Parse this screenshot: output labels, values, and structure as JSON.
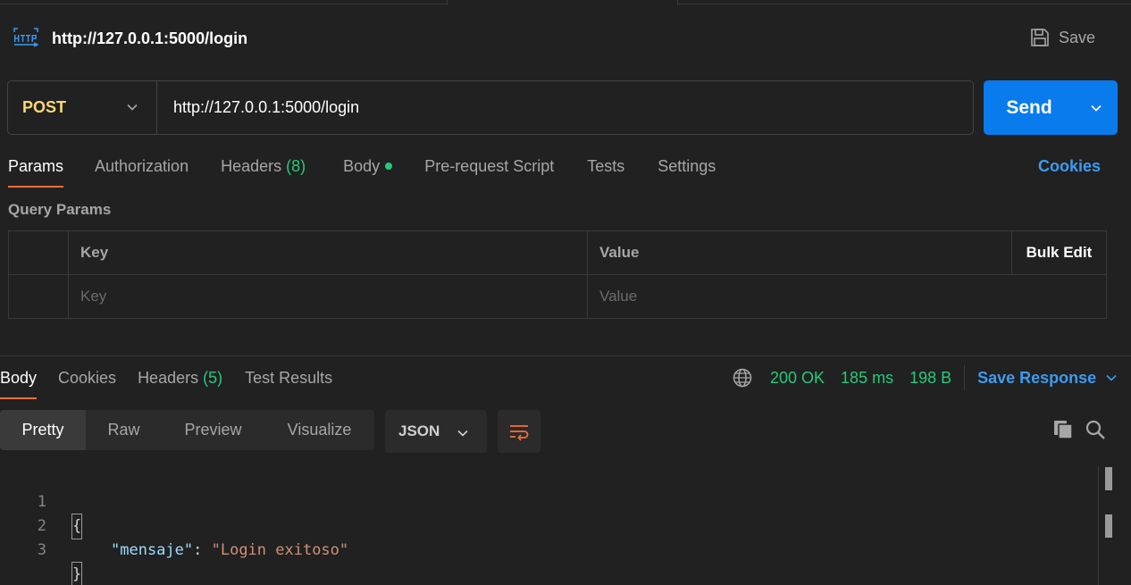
{
  "request": {
    "title": "http://127.0.0.1:5000/login",
    "save_label": "Save",
    "method": "POST",
    "url": "http://127.0.0.1:5000/login",
    "send_label": "Send"
  },
  "request_tabs": [
    {
      "label": "Params",
      "active": true
    },
    {
      "label": "Authorization"
    },
    {
      "label": "Headers",
      "count": "(8)"
    },
    {
      "label": "Body",
      "has_dot": true
    },
    {
      "label": "Pre-request Script"
    },
    {
      "label": "Tests"
    },
    {
      "label": "Settings"
    }
  ],
  "cookies_label": "Cookies",
  "query_params": {
    "title": "Query Params",
    "columns": {
      "key": "Key",
      "value": "Value",
      "bulk_edit": "Bulk Edit"
    },
    "placeholders": {
      "key": "Key",
      "value": "Value"
    }
  },
  "response_tabs": [
    {
      "label": "Body",
      "active": true
    },
    {
      "label": "Cookies"
    },
    {
      "label": "Headers",
      "count": "(5)"
    },
    {
      "label": "Test Results"
    }
  ],
  "response_status": {
    "status": "200 OK",
    "time": "185 ms",
    "size": "198 B",
    "save_response_label": "Save Response"
  },
  "format_tabs": [
    "Pretty",
    "Raw",
    "Preview",
    "Visualize"
  ],
  "format_active": "Pretty",
  "language": "JSON",
  "code": {
    "line_numbers": [
      "1",
      "2",
      "3"
    ],
    "open_brace": "{",
    "close_brace": "}",
    "key": "\"mensaje\"",
    "colon": ": ",
    "value": "\"Login exitoso\""
  },
  "colors": {
    "background": "#212121",
    "accent_send": "#097bed",
    "method_post": "#ffd874",
    "success": "#27c97a",
    "link": "#3d9bf0",
    "active_tab_underline": "#ff6c37"
  },
  "icons": [
    "http-icon",
    "save-icon",
    "chevron-down-icon",
    "globe-icon",
    "wrap-lines-icon",
    "copy-icon",
    "search-icon"
  ]
}
